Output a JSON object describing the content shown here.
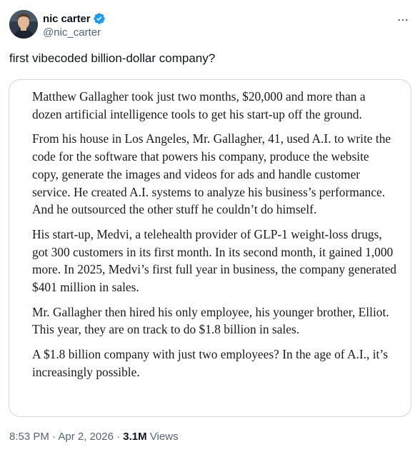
{
  "author": {
    "display_name": "nic carter",
    "handle": "@nic_carter",
    "verified": true,
    "verified_color": "#1d9bf0"
  },
  "tweet": {
    "text": "first vibecoded billion-dollar company?"
  },
  "quote_image": {
    "paragraphs": [
      "Matthew Gallagher took just two months, $20,000 and more than a dozen artificial intelligence tools to get his start-up off the ground.",
      "From his house in Los Angeles, Mr. Gallagher, 41, used A.I. to write the code for the software that powers his company, produce the website copy, generate the images and videos for ads and handle customer service. He created A.I. systems to analyze his business’s performance. And he outsourced the other stuff he couldn’t do himself.",
      "His start-up, Medvi, a telehealth provider of GLP-1 weight-loss drugs, got 300 customers in its first month. In its second month, it gained 1,000 more. In 2025, Medvi’s first full year in business, the company generated $401 million in sales.",
      "Mr. Gallagher then hired his only employee, his younger brother, Elliot. This year, they are on track to do $1.8 billion in sales.",
      "A $1.8 billion company with just two employees? In the age of A.I., it’s increasingly possible."
    ]
  },
  "meta": {
    "time": "8:53 PM",
    "separator": " · ",
    "date": "Apr 2, 2026",
    "views_count": "3.1M",
    "views_label": " Views"
  },
  "icons": {
    "more": "more-horizontal-icon",
    "verified": "verified-badge-icon"
  }
}
